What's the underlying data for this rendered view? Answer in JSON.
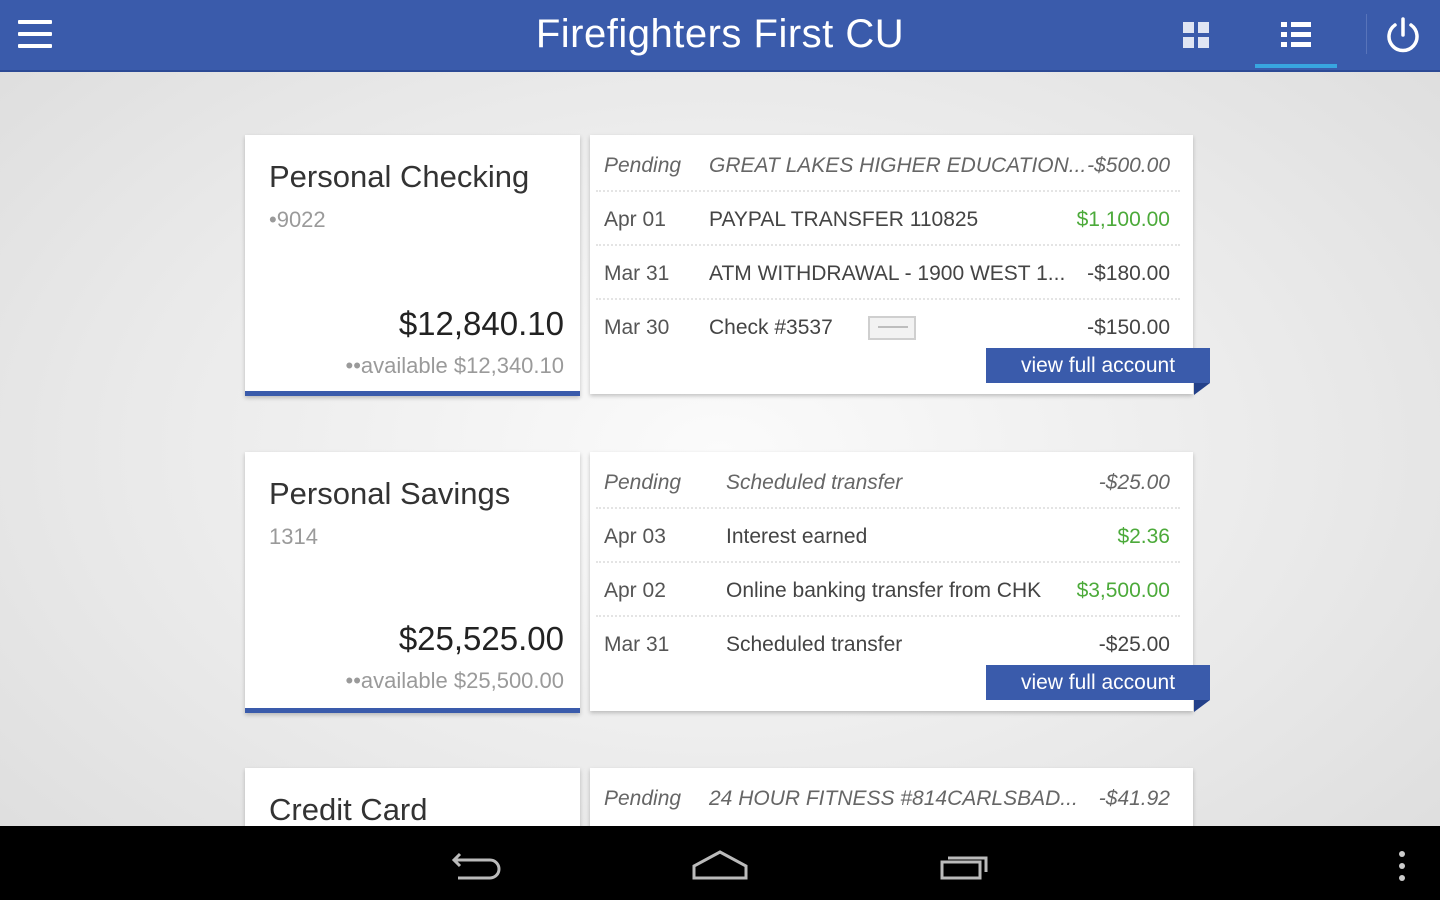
{
  "app": {
    "title": "Firefighters First CU",
    "brand_color": "#3a5bab",
    "accent_color": "#38a6e0",
    "active_view": "list"
  },
  "header_icons": [
    "menu-icon",
    "grid-view-icon",
    "list-view-icon",
    "power-icon"
  ],
  "accounts": [
    {
      "name": "Personal Checking",
      "number": "•9022",
      "balance": "$12,840.10",
      "available": "••available $12,340.10",
      "transactions": [
        {
          "date": "Pending",
          "description": "GREAT LAKES HIGHER EDUCATION...",
          "amount": "-$500.00",
          "pending": true
        },
        {
          "date": "Apr 01",
          "description": "PAYPAL TRANSFER 110825",
          "amount": "$1,100.00",
          "positive": true
        },
        {
          "date": "Mar 31",
          "description": "ATM WITHDRAWAL - 1900 WEST 1...",
          "amount": "-$180.00"
        },
        {
          "date": "Mar 30",
          "description": "Check #3537",
          "amount": "-$150.00",
          "has_check_image": true
        }
      ],
      "view_label": "view full account"
    },
    {
      "name": "Personal Savings",
      "number": "1314",
      "balance": "$25,525.00",
      "available": "••available $25,500.00",
      "transactions": [
        {
          "date": "Pending",
          "description": "Scheduled transfer",
          "amount": "-$25.00",
          "pending": true
        },
        {
          "date": "Apr 03",
          "description": "Interest earned",
          "amount": "$2.36",
          "positive": true
        },
        {
          "date": "Apr 02",
          "description": "Online banking transfer from CHK",
          "amount": "$3,500.00",
          "positive": true
        },
        {
          "date": "Mar 31",
          "description": "Scheduled transfer",
          "amount": "-$25.00"
        }
      ],
      "view_label": "view full account"
    },
    {
      "name": "Credit Card",
      "transactions": [
        {
          "date": "Pending",
          "description": "24 HOUR FITNESS #814CARLSBAD...",
          "amount": "-$41.92",
          "pending": true
        }
      ]
    }
  ],
  "system_nav": [
    "back-icon",
    "home-icon",
    "recent-apps-icon",
    "overflow-menu-icon"
  ]
}
